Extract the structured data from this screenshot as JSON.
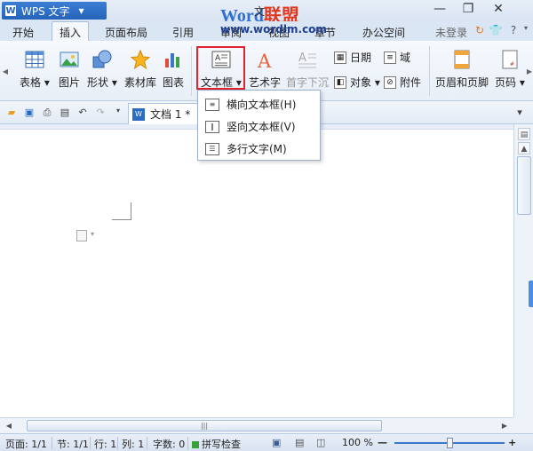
{
  "titlebar": {
    "app_name": "WPS 文字",
    "watermark_part1": "Word",
    "watermark_part2": "联盟",
    "watermark_url": "www.wordlm.com",
    "doc_title": "文"
  },
  "menubar": {
    "tabs": [
      {
        "label": "开始"
      },
      {
        "label": "插入"
      },
      {
        "label": "页面布局"
      },
      {
        "label": "引用"
      },
      {
        "label": "审阅"
      },
      {
        "label": "视图"
      },
      {
        "label": "章节"
      },
      {
        "label": "办公空间"
      }
    ],
    "active_tab": "插入",
    "login_label": "未登录",
    "help_label": "?"
  },
  "ribbon": {
    "table": "表格",
    "picture": "图片",
    "shapes": "形状",
    "clip": "素材库",
    "chart": "图表",
    "textbox": "文本框",
    "wordart": "艺术字",
    "dropcap": "首字下沉",
    "date": "日期",
    "field": "域",
    "object": "对象",
    "attachment": "附件",
    "header_footer": "页眉和页脚",
    "page_number": "页码"
  },
  "document_tab": {
    "name": "文档 1 *"
  },
  "textbox_menu": {
    "items": [
      {
        "label": "横向文本框(H)"
      },
      {
        "label": "竖向文本框(V)"
      },
      {
        "label": "多行文字(M)"
      }
    ]
  },
  "statusbar": {
    "page": "页面: 1/1",
    "section": "节: 1/1",
    "row": "行: 1",
    "col": "列: 1",
    "wordcount": "字数: 0",
    "spell": "拼写检查",
    "zoom": "100 %"
  },
  "colors": {
    "accent": "#2563b8",
    "highlight": "#e0232c"
  }
}
